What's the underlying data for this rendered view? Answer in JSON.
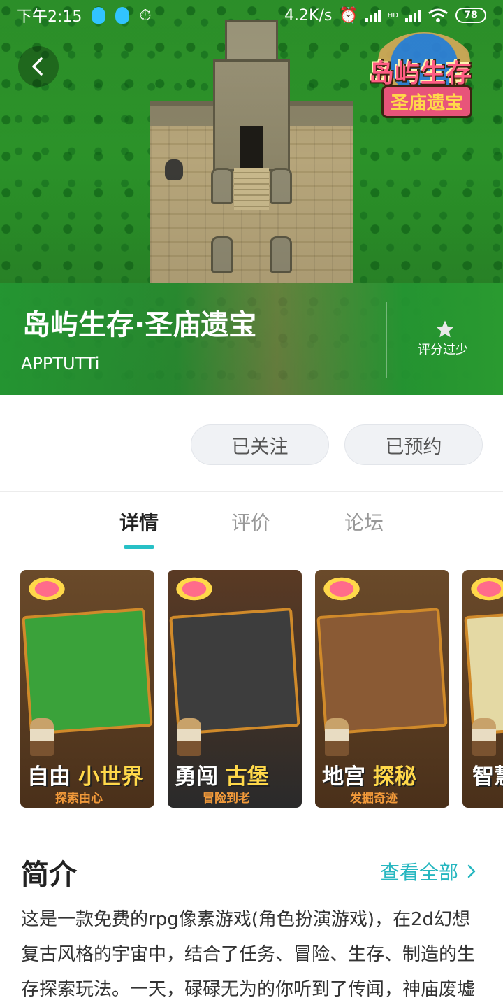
{
  "status_bar": {
    "time": "下午2:15",
    "net_speed": "4.2K/s",
    "battery": "78",
    "network_label": "HD"
  },
  "hero": {
    "logo_line1": "岛屿生存",
    "logo_line2": "圣庙遗宝"
  },
  "app": {
    "title": "岛屿生存·圣庙遗宝",
    "developer": "APPTUTTi",
    "rating_text": "评分过少"
  },
  "actions": {
    "follow_label": "已关注",
    "reserve_label": "已预约"
  },
  "tabs": [
    {
      "label": "详情",
      "active": true
    },
    {
      "label": "评价",
      "active": false
    },
    {
      "label": "论坛",
      "active": false
    }
  ],
  "screenshots": [
    {
      "main_a": "自由",
      "main_b": "小世界",
      "sub": "探索由心"
    },
    {
      "main_a": "勇闯",
      "main_b": "古堡",
      "sub": "冒险到老"
    },
    {
      "main_a": "地宫",
      "main_b": "探秘",
      "sub": "发掘奇迹"
    },
    {
      "main_a": "智慧",
      "main_b": "",
      "sub": ""
    }
  ],
  "intro": {
    "title": "简介",
    "see_all": "查看全部",
    "text": "这是一款免费的rpg像素游戏(角色扮演游戏)，在2d幻想复古风格的宇宙中，结合了任务、冒险、生存、制造的生存探索玩法。一天，碌碌无为的你听到了传闻，神庙废墟中有魔法神器。为了证明"
  },
  "colors": {
    "accent": "#27c0c6",
    "link": "#27b7c0",
    "hero_green": "#2a9a30"
  }
}
